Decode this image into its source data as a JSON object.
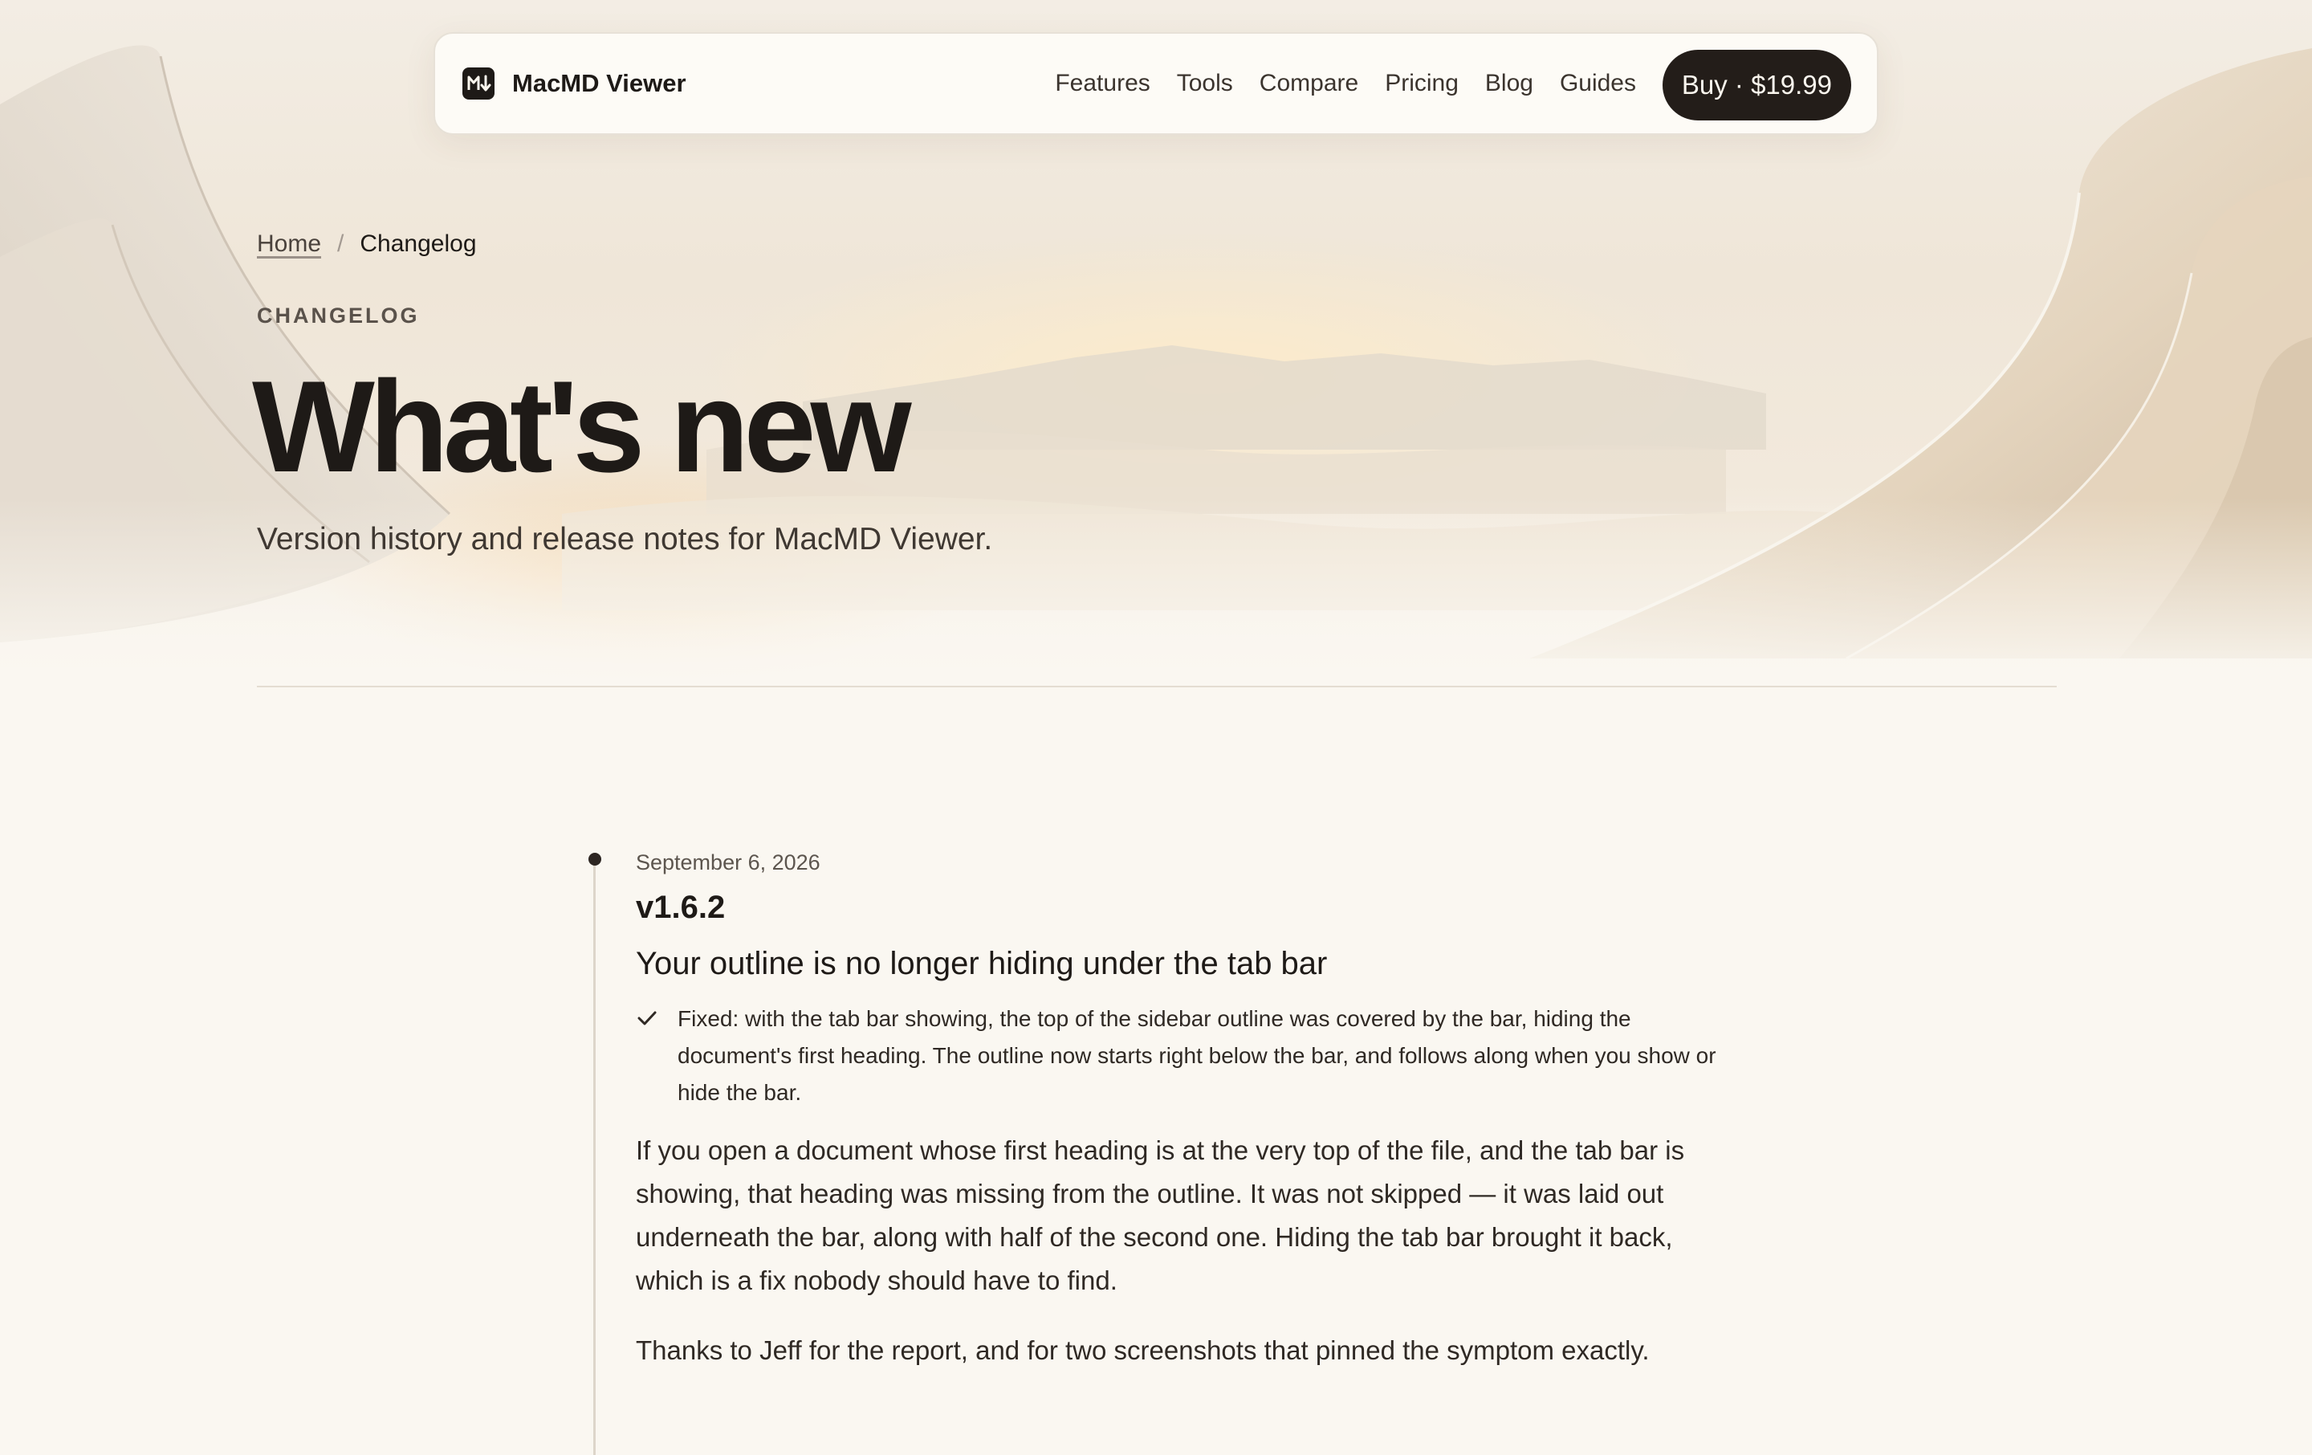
{
  "nav": {
    "brand": "MacMD Viewer",
    "links": [
      "Features",
      "Tools",
      "Compare",
      "Pricing",
      "Blog",
      "Guides"
    ],
    "buy_label": "Buy · $19.99"
  },
  "breadcrumb": {
    "home": "Home",
    "separator": "/",
    "current": "Changelog"
  },
  "hero": {
    "eyebrow": "CHANGELOG",
    "title": "What's new",
    "subtitle": "Version history and release notes for MacMD Viewer."
  },
  "entries": [
    {
      "date": "September 6, 2026",
      "version": "v1.6.2",
      "title": "Your outline is no longer hiding under the tab bar",
      "fixes": [
        "Fixed: with the tab bar showing, the top of the sidebar outline was covered by the bar, hiding the document's first heading. The outline now starts right below the bar, and follows along when you show or hide the bar."
      ],
      "paragraphs": [
        "If you open a document whose first heading is at the very top of the file, and the tab bar is showing, that heading was missing from the outline. It was not skipped — it was laid out underneath the bar, along with half of the second one. Hiding the tab bar brought it back, which is a fix nobody should have to find.",
        "Thanks to Jeff for the report, and for two screenshots that pinned the symptom exactly."
      ]
    }
  ],
  "colors": {
    "background": "#faf7f1",
    "ink": "#1e1a17",
    "button": "#231d19",
    "accent_glow": "#f5cd96"
  },
  "icons": {
    "logo": "markdown-down-arrow-icon",
    "fix": "checkmark-icon"
  }
}
